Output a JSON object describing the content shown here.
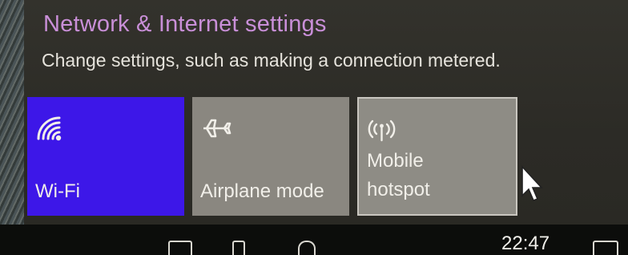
{
  "panel": {
    "title": "Network & Internet settings",
    "subtitle": "Change settings, such as making a connection metered."
  },
  "tiles": [
    {
      "label": "Wi-Fi",
      "icon": "wifi-icon",
      "state": "on",
      "color": "#3d17e8"
    },
    {
      "label": "Airplane mode",
      "icon": "airplane-icon",
      "state": "off",
      "color": "#8a8780"
    },
    {
      "label": "Mobile\nhotspot",
      "icon": "hotspot-icon",
      "state": "off",
      "color": "#8e8c85"
    }
  ],
  "taskbar": {
    "time": "22:47"
  },
  "colors": {
    "accent": "#3d17e8",
    "title_purple": "#c98fd8"
  }
}
